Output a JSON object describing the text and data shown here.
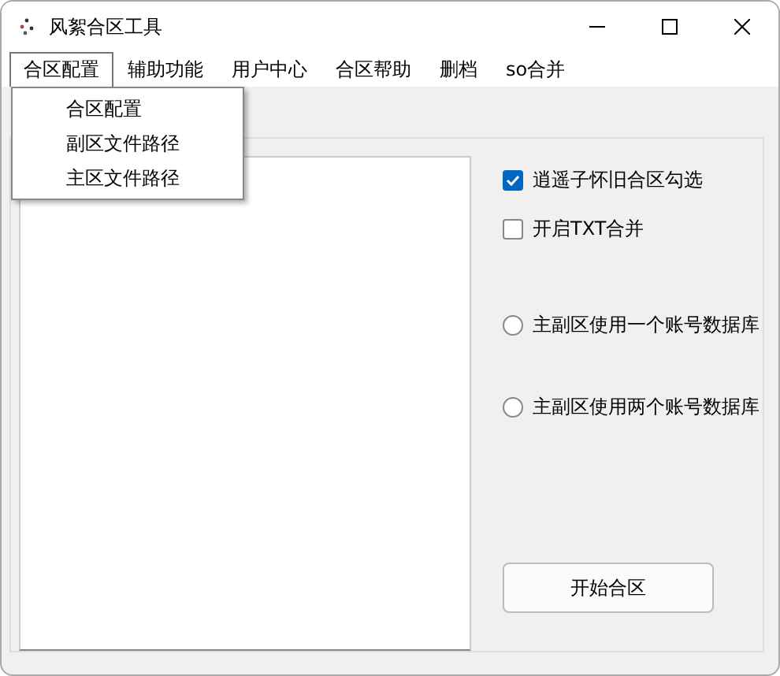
{
  "window": {
    "title": "风絮合区工具"
  },
  "menu": [
    {
      "label": "合区配置",
      "selected": true
    },
    {
      "label": "辅助功能",
      "selected": false
    },
    {
      "label": "用户中心",
      "selected": false
    },
    {
      "label": "合区帮助",
      "selected": false
    },
    {
      "label": "删档",
      "selected": false
    },
    {
      "label": "so合并",
      "selected": false
    }
  ],
  "dropdown": {
    "items": [
      "合区配置",
      "副区文件路径",
      "主区文件路径"
    ]
  },
  "options": [
    {
      "kind": "checkbox",
      "label": "逍遥子怀旧合区勾选",
      "checked": true
    },
    {
      "kind": "checkbox",
      "label": "开启TXT合并",
      "checked": false
    },
    {
      "kind": "radio",
      "label": "主副区使用一个账号数据库",
      "selected": false
    },
    {
      "kind": "radio",
      "label": "主副区使用两个账号数据库",
      "selected": false
    }
  ],
  "start_button": "开始合区"
}
